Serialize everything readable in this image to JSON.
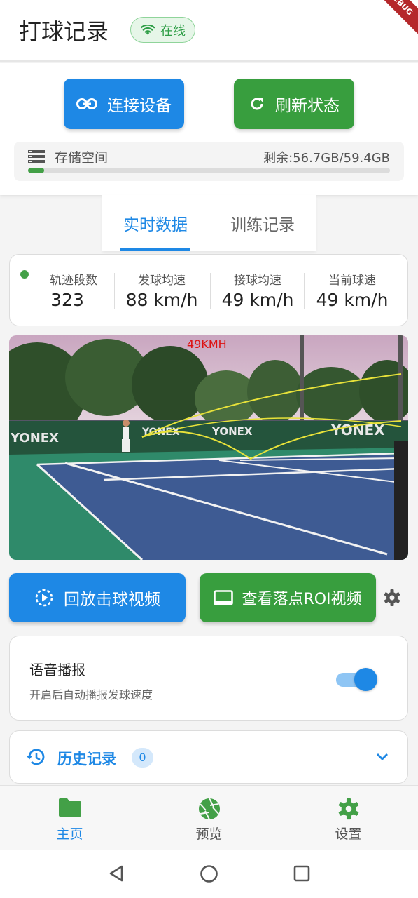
{
  "app": {
    "title": "打球记录",
    "status": "在线",
    "debug_banner": "DEBUG"
  },
  "actions": {
    "connect_label": "连接设备",
    "refresh_label": "刷新状态"
  },
  "storage": {
    "label": "存储空间",
    "remaining_text": "剩余:56.7GB/59.4GB",
    "used_fraction": 0.045
  },
  "tabs": [
    {
      "label": "实时数据",
      "active": true
    },
    {
      "label": "训练记录",
      "active": false
    }
  ],
  "stats": [
    {
      "label": "轨迹段数",
      "value": "323"
    },
    {
      "label": "发球均速",
      "value": "88 km/h"
    },
    {
      "label": "接球均速",
      "value": "49 km/h"
    },
    {
      "label": "当前球速",
      "value": "49 km/h"
    }
  ],
  "video": {
    "speed_overlay": "49KMH",
    "banner_text": "YONEX"
  },
  "video_actions": {
    "replay_label": "回放击球视频",
    "roi_label": "查看落点ROI视频"
  },
  "voice": {
    "title": "语音播报",
    "subtitle": "开启后自动播报发球速度",
    "enabled": true
  },
  "history": {
    "title": "历史记录",
    "count": "0"
  },
  "bottom_nav": [
    {
      "label": "主页",
      "icon": "folder-icon",
      "active": true
    },
    {
      "label": "预览",
      "icon": "camera-shutter-icon",
      "active": false
    },
    {
      "label": "设置",
      "icon": "gear-icon",
      "active": false
    }
  ],
  "colors": {
    "primary_blue": "#1e88e5",
    "primary_green": "#389e3e",
    "trajectory": "#e8e23a"
  }
}
